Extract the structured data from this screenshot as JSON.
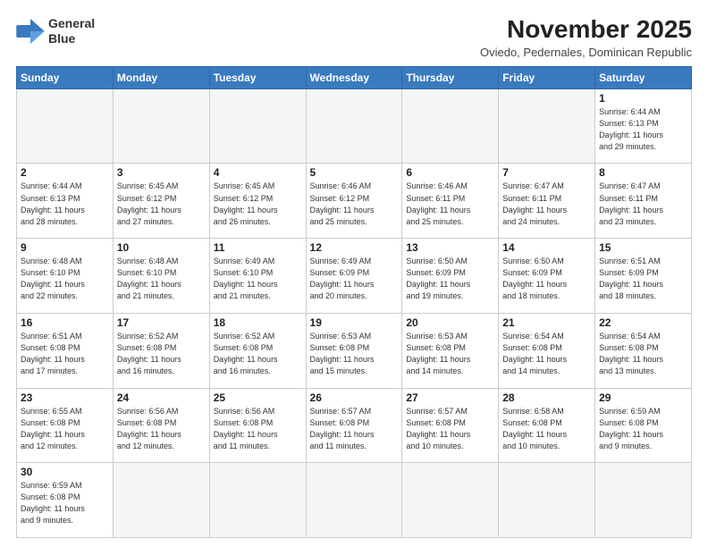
{
  "logo": {
    "line1": "General",
    "line2": "Blue"
  },
  "title": "November 2025",
  "subtitle": "Oviedo, Pedernales, Dominican Republic",
  "days_header": [
    "Sunday",
    "Monday",
    "Tuesday",
    "Wednesday",
    "Thursday",
    "Friday",
    "Saturday"
  ],
  "weeks": [
    [
      {
        "num": "",
        "info": ""
      },
      {
        "num": "",
        "info": ""
      },
      {
        "num": "",
        "info": ""
      },
      {
        "num": "",
        "info": ""
      },
      {
        "num": "",
        "info": ""
      },
      {
        "num": "",
        "info": ""
      },
      {
        "num": "1",
        "info": "Sunrise: 6:44 AM\nSunset: 6:13 PM\nDaylight: 11 hours\nand 29 minutes."
      }
    ],
    [
      {
        "num": "2",
        "info": "Sunrise: 6:44 AM\nSunset: 6:13 PM\nDaylight: 11 hours\nand 28 minutes."
      },
      {
        "num": "3",
        "info": "Sunrise: 6:45 AM\nSunset: 6:12 PM\nDaylight: 11 hours\nand 27 minutes."
      },
      {
        "num": "4",
        "info": "Sunrise: 6:45 AM\nSunset: 6:12 PM\nDaylight: 11 hours\nand 26 minutes."
      },
      {
        "num": "5",
        "info": "Sunrise: 6:46 AM\nSunset: 6:12 PM\nDaylight: 11 hours\nand 25 minutes."
      },
      {
        "num": "6",
        "info": "Sunrise: 6:46 AM\nSunset: 6:11 PM\nDaylight: 11 hours\nand 25 minutes."
      },
      {
        "num": "7",
        "info": "Sunrise: 6:47 AM\nSunset: 6:11 PM\nDaylight: 11 hours\nand 24 minutes."
      },
      {
        "num": "8",
        "info": "Sunrise: 6:47 AM\nSunset: 6:11 PM\nDaylight: 11 hours\nand 23 minutes."
      }
    ],
    [
      {
        "num": "9",
        "info": "Sunrise: 6:48 AM\nSunset: 6:10 PM\nDaylight: 11 hours\nand 22 minutes."
      },
      {
        "num": "10",
        "info": "Sunrise: 6:48 AM\nSunset: 6:10 PM\nDaylight: 11 hours\nand 21 minutes."
      },
      {
        "num": "11",
        "info": "Sunrise: 6:49 AM\nSunset: 6:10 PM\nDaylight: 11 hours\nand 21 minutes."
      },
      {
        "num": "12",
        "info": "Sunrise: 6:49 AM\nSunset: 6:09 PM\nDaylight: 11 hours\nand 20 minutes."
      },
      {
        "num": "13",
        "info": "Sunrise: 6:50 AM\nSunset: 6:09 PM\nDaylight: 11 hours\nand 19 minutes."
      },
      {
        "num": "14",
        "info": "Sunrise: 6:50 AM\nSunset: 6:09 PM\nDaylight: 11 hours\nand 18 minutes."
      },
      {
        "num": "15",
        "info": "Sunrise: 6:51 AM\nSunset: 6:09 PM\nDaylight: 11 hours\nand 18 minutes."
      }
    ],
    [
      {
        "num": "16",
        "info": "Sunrise: 6:51 AM\nSunset: 6:08 PM\nDaylight: 11 hours\nand 17 minutes."
      },
      {
        "num": "17",
        "info": "Sunrise: 6:52 AM\nSunset: 6:08 PM\nDaylight: 11 hours\nand 16 minutes."
      },
      {
        "num": "18",
        "info": "Sunrise: 6:52 AM\nSunset: 6:08 PM\nDaylight: 11 hours\nand 16 minutes."
      },
      {
        "num": "19",
        "info": "Sunrise: 6:53 AM\nSunset: 6:08 PM\nDaylight: 11 hours\nand 15 minutes."
      },
      {
        "num": "20",
        "info": "Sunrise: 6:53 AM\nSunset: 6:08 PM\nDaylight: 11 hours\nand 14 minutes."
      },
      {
        "num": "21",
        "info": "Sunrise: 6:54 AM\nSunset: 6:08 PM\nDaylight: 11 hours\nand 14 minutes."
      },
      {
        "num": "22",
        "info": "Sunrise: 6:54 AM\nSunset: 6:08 PM\nDaylight: 11 hours\nand 13 minutes."
      }
    ],
    [
      {
        "num": "23",
        "info": "Sunrise: 6:55 AM\nSunset: 6:08 PM\nDaylight: 11 hours\nand 12 minutes."
      },
      {
        "num": "24",
        "info": "Sunrise: 6:56 AM\nSunset: 6:08 PM\nDaylight: 11 hours\nand 12 minutes."
      },
      {
        "num": "25",
        "info": "Sunrise: 6:56 AM\nSunset: 6:08 PM\nDaylight: 11 hours\nand 11 minutes."
      },
      {
        "num": "26",
        "info": "Sunrise: 6:57 AM\nSunset: 6:08 PM\nDaylight: 11 hours\nand 11 minutes."
      },
      {
        "num": "27",
        "info": "Sunrise: 6:57 AM\nSunset: 6:08 PM\nDaylight: 11 hours\nand 10 minutes."
      },
      {
        "num": "28",
        "info": "Sunrise: 6:58 AM\nSunset: 6:08 PM\nDaylight: 11 hours\nand 10 minutes."
      },
      {
        "num": "29",
        "info": "Sunrise: 6:59 AM\nSunset: 6:08 PM\nDaylight: 11 hours\nand 9 minutes."
      }
    ],
    [
      {
        "num": "30",
        "info": "Sunrise: 6:59 AM\nSunset: 6:08 PM\nDaylight: 11 hours\nand 9 minutes."
      },
      {
        "num": "",
        "info": ""
      },
      {
        "num": "",
        "info": ""
      },
      {
        "num": "",
        "info": ""
      },
      {
        "num": "",
        "info": ""
      },
      {
        "num": "",
        "info": ""
      },
      {
        "num": "",
        "info": ""
      }
    ]
  ]
}
